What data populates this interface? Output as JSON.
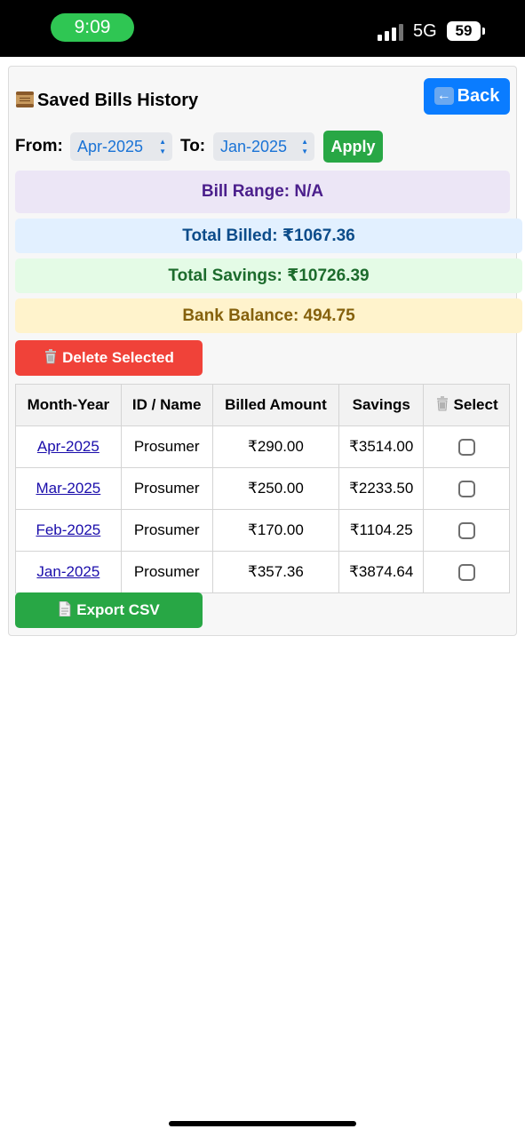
{
  "status_bar": {
    "time": "9:09",
    "network": "5G",
    "battery": "59"
  },
  "page": {
    "title": "Saved Bills History",
    "back_label": "Back"
  },
  "filters": {
    "from_label": "From:",
    "from_value": "Apr-2025",
    "to_label": "To:",
    "to_value": "Jan-2025",
    "apply_label": "Apply"
  },
  "summary": {
    "bill_range": "Bill Range: N/A",
    "total_billed": "Total Billed: ₹1067.36",
    "total_savings": "Total Savings: ₹10726.39",
    "bank_balance": "Bank Balance: 494.75"
  },
  "actions": {
    "delete_label": "Delete Selected",
    "export_label": "Export CSV"
  },
  "table": {
    "headers": [
      "Month-Year",
      "ID / Name",
      "Billed Amount",
      "Savings",
      "Select"
    ],
    "rows": [
      {
        "month": "Apr-2025",
        "name": "Prosumer",
        "billed": "₹290.00",
        "savings": "₹3514.00",
        "selected": false
      },
      {
        "month": "Mar-2025",
        "name": "Prosumer",
        "billed": "₹250.00",
        "savings": "₹2233.50",
        "selected": false
      },
      {
        "month": "Feb-2025",
        "name": "Prosumer",
        "billed": "₹170.00",
        "savings": "₹1104.25",
        "selected": false
      },
      {
        "month": "Jan-2025",
        "name": "Prosumer",
        "billed": "₹357.36",
        "savings": "₹3874.64",
        "selected": false
      }
    ]
  },
  "icons": {
    "title": "scroll-icon",
    "back": "back-arrow-icon",
    "delete": "trash-icon",
    "select_header": "trash-icon",
    "export": "document-icon"
  },
  "colors": {
    "back_button": "#0a7cff",
    "apply_button": "#28a745",
    "delete_button": "#f04239",
    "export_button": "#28a745",
    "range_band": "#ece6f6",
    "billed_band": "#e2f0ff",
    "savings_band": "#e4fbe6",
    "bank_band": "#fff3cc"
  }
}
